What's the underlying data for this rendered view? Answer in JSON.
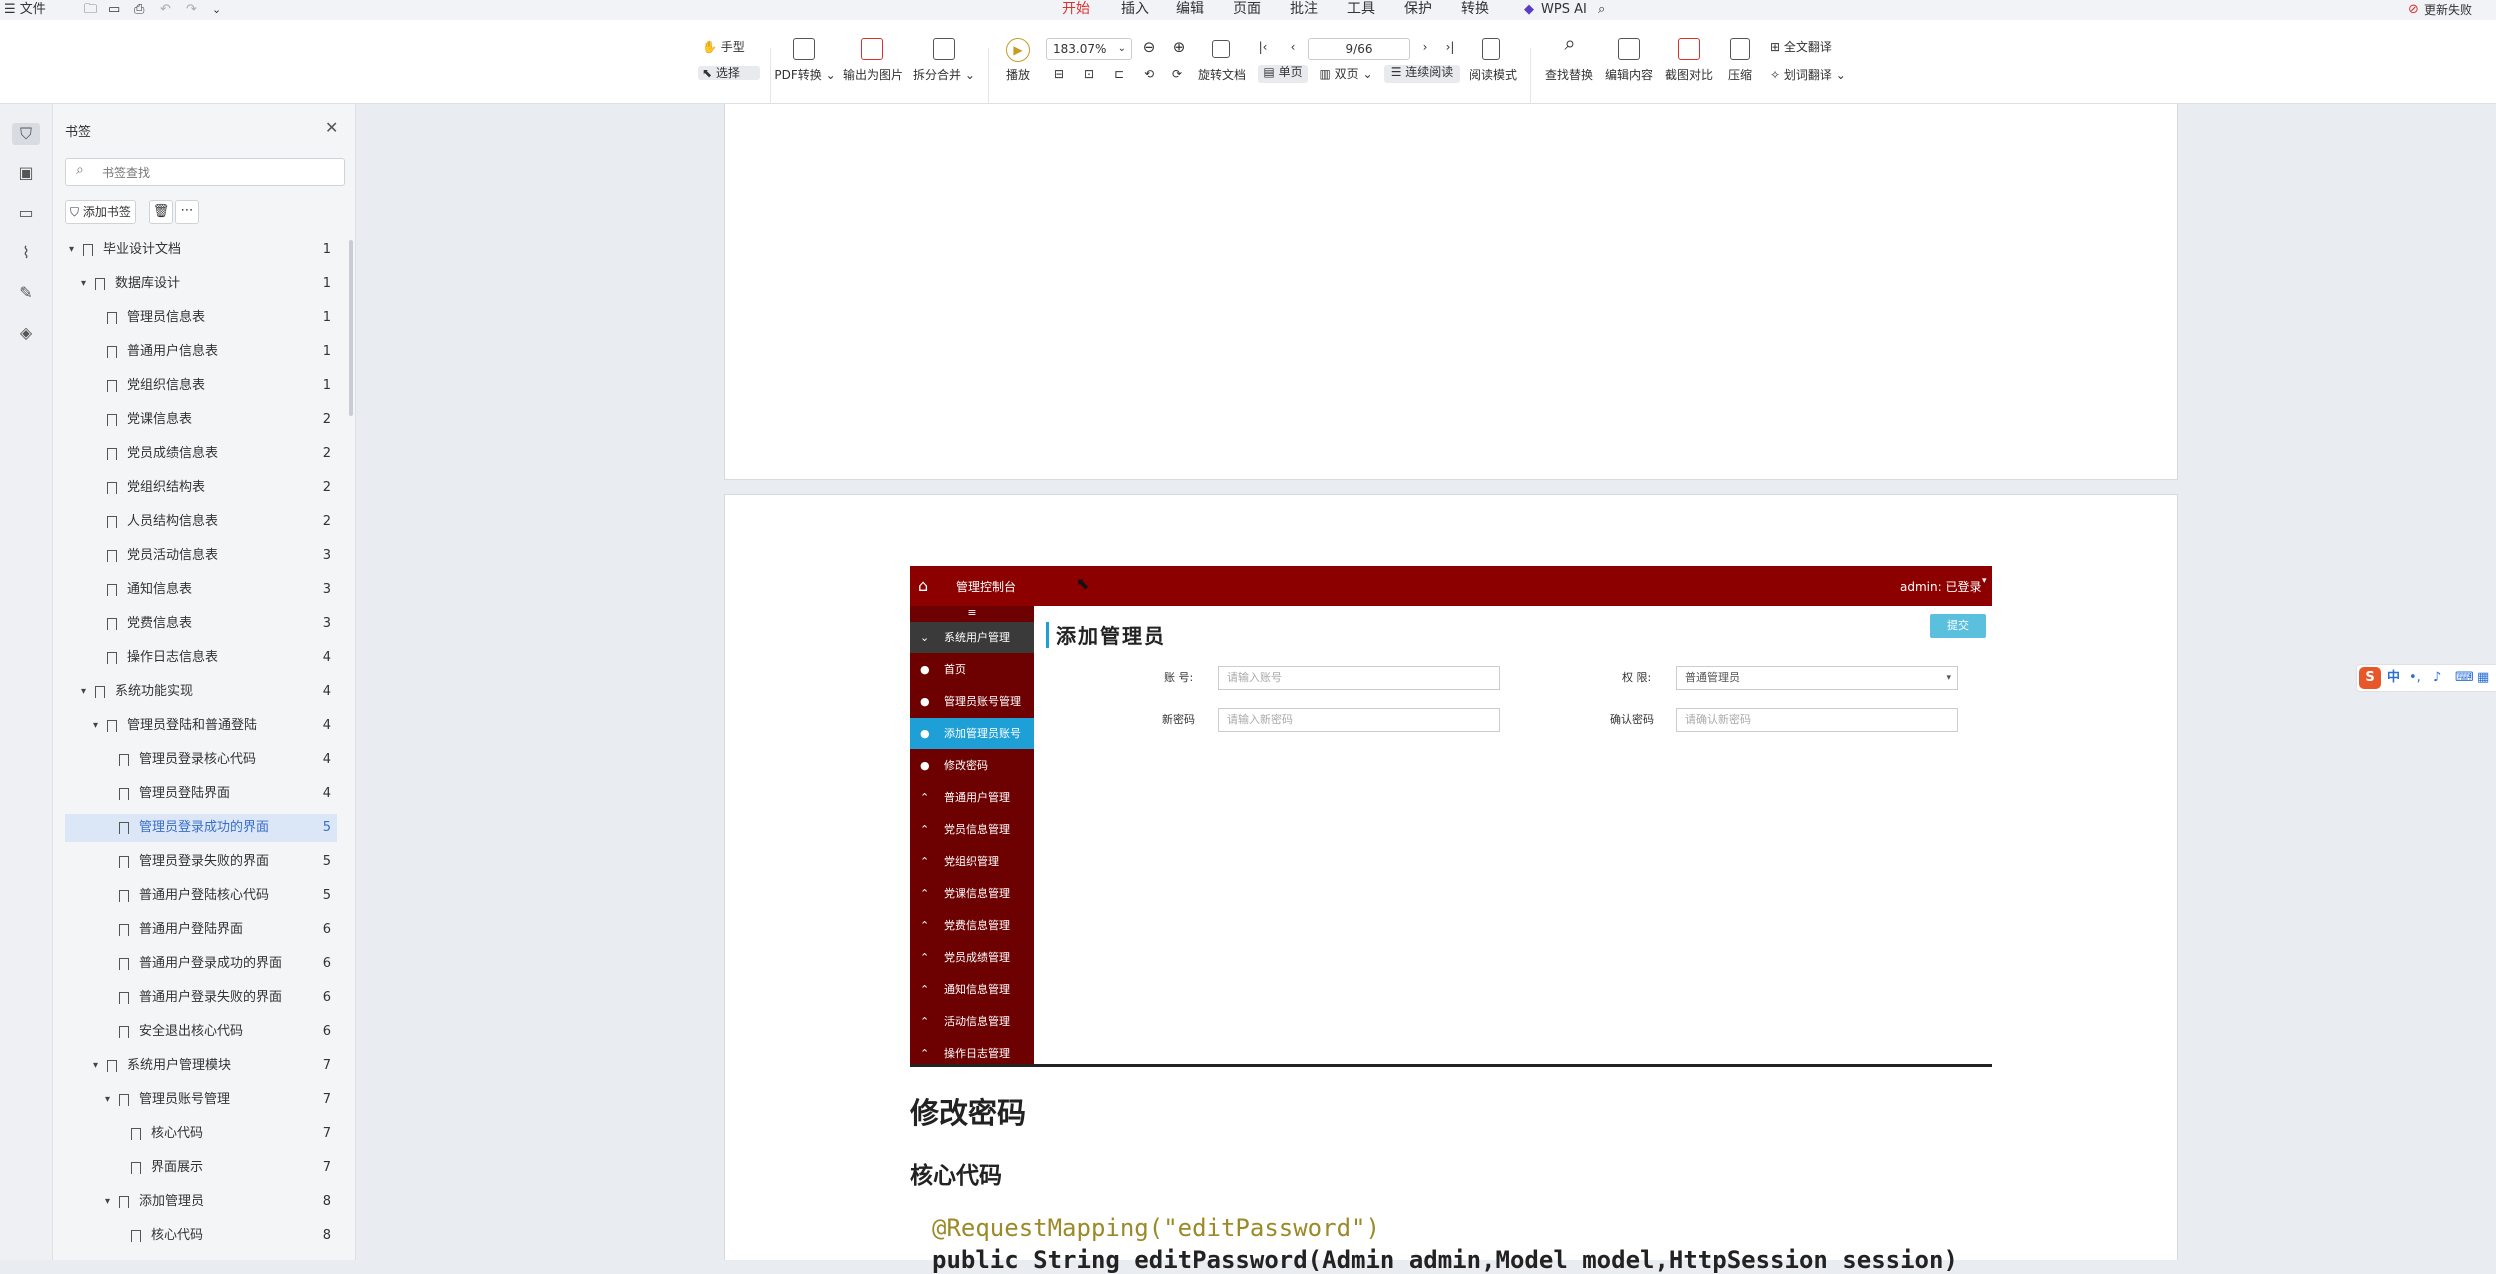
{
  "menubar": {
    "file": "文件",
    "tabs": [
      {
        "label": "开始",
        "active": true
      },
      {
        "label": "插入"
      },
      {
        "label": "编辑"
      },
      {
        "label": "页面"
      },
      {
        "label": "批注"
      },
      {
        "label": "工具"
      },
      {
        "label": "保护"
      },
      {
        "label": "转换"
      }
    ],
    "wps_ai": "WPS AI",
    "update": "更新失败"
  },
  "toolbar": {
    "hand": "手型",
    "select": "选择",
    "pdf_convert": "PDF转换",
    "export_image": "输出为图片",
    "split_merge": "拆分合并",
    "play": "播放",
    "zoom": "183.07%",
    "page_input": "9/66",
    "rotate": "旋转文档",
    "single": "单页",
    "double": "双页",
    "continuous": "连续阅读",
    "reading_mode": "阅读模式",
    "find_replace": "查找替换",
    "edit_content": "编辑内容",
    "compare": "截图对比",
    "compress": "压缩",
    "full_translate": "全文翻译",
    "word_translate": "划词翻译"
  },
  "panel": {
    "title": "书签",
    "search_placeholder": "书签查找",
    "add_bookmark": "添加书签",
    "items": [
      {
        "label": "毕业设计文档",
        "page": "1",
        "level": 0,
        "expanded": true
      },
      {
        "label": "数据库设计",
        "page": "1",
        "level": 1,
        "expanded": true
      },
      {
        "label": "管理员信息表",
        "page": "1",
        "level": 2
      },
      {
        "label": "普通用户信息表",
        "page": "1",
        "level": 2
      },
      {
        "label": "党组织信息表",
        "page": "1",
        "level": 2
      },
      {
        "label": "党课信息表",
        "page": "2",
        "level": 2
      },
      {
        "label": "党员成绩信息表",
        "page": "2",
        "level": 2
      },
      {
        "label": "党组织结构表",
        "page": "2",
        "level": 2
      },
      {
        "label": "人员结构信息表",
        "page": "2",
        "level": 2
      },
      {
        "label": "党员活动信息表",
        "page": "3",
        "level": 2
      },
      {
        "label": "通知信息表",
        "page": "3",
        "level": 2
      },
      {
        "label": "党费信息表",
        "page": "3",
        "level": 2
      },
      {
        "label": "操作日志信息表",
        "page": "4",
        "level": 2
      },
      {
        "label": "系统功能实现",
        "page": "4",
        "level": 1,
        "expanded": true
      },
      {
        "label": "管理员登陆和普通登陆",
        "page": "4",
        "level": 2,
        "expanded": true
      },
      {
        "label": "管理员登录核心代码",
        "page": "4",
        "level": 3
      },
      {
        "label": "管理员登陆界面",
        "page": "4",
        "level": 3
      },
      {
        "label": "管理员登录成功的界面",
        "page": "5",
        "level": 3,
        "selected": true
      },
      {
        "label": "管理员登录失败的界面",
        "page": "5",
        "level": 3
      },
      {
        "label": "普通用户登陆核心代码",
        "page": "5",
        "level": 3
      },
      {
        "label": "普通用户登陆界面",
        "page": "6",
        "level": 3
      },
      {
        "label": "普通用户登录成功的界面",
        "page": "6",
        "level": 3
      },
      {
        "label": "普通用户登录失败的界面",
        "page": "6",
        "level": 3
      },
      {
        "label": "安全退出核心代码",
        "page": "6",
        "level": 3
      },
      {
        "label": "系统用户管理模块",
        "page": "7",
        "level": 2,
        "expanded": true
      },
      {
        "label": "管理员账号管理",
        "page": "7",
        "level": 3,
        "expanded": true
      },
      {
        "label": "核心代码",
        "page": "7",
        "level": 4
      },
      {
        "label": "界面展示",
        "page": "7",
        "level": 4
      },
      {
        "label": "添加管理员",
        "page": "8",
        "level": 3,
        "expanded": true
      },
      {
        "label": "核心代码",
        "page": "8",
        "level": 4
      }
    ]
  },
  "shot": {
    "console": "管理控制台",
    "admin": "admin: 已登录",
    "menu_toggle": "≡",
    "side_items": [
      {
        "label": "系统用户管理",
        "active": false,
        "header": true
      },
      {
        "label": "首页"
      },
      {
        "label": "管理员账号管理"
      },
      {
        "label": "添加管理员账号",
        "active": true
      },
      {
        "label": "修改密码"
      },
      {
        "label": "普通用户管理"
      },
      {
        "label": "党员信息管理"
      },
      {
        "label": "党组织管理"
      },
      {
        "label": "党课信息管理"
      },
      {
        "label": "党费信息管理"
      },
      {
        "label": "党员成绩管理"
      },
      {
        "label": "通知信息管理"
      },
      {
        "label": "活动信息管理"
      },
      {
        "label": "操作日志管理"
      }
    ],
    "form_title": "添加管理员",
    "submit": "提交",
    "account_label": "账 号:",
    "account_placeholder": "请输入账号",
    "role_label": "权 限:",
    "role_value": "普通管理员",
    "new_pwd_label": "新密码",
    "new_pwd_placeholder": "请输入新密码",
    "confirm_label": "确认密码",
    "confirm_placeholder": "请确认新密码"
  },
  "doc": {
    "heading": "修改密码",
    "subheading": "核心代码",
    "code_line1": "@RequestMapping(\"editPassword\")",
    "code_line2": "public String editPassword(Admin admin,Model model,HttpSession session)"
  },
  "ime": {
    "label": "中"
  },
  "colors": {
    "accent": "#d9312b",
    "shot_header": "#8c0000",
    "shot_sidebar": "#6d0000",
    "shot_active": "#1e9fd6",
    "selected_bookmark": "#dbe6f7"
  }
}
